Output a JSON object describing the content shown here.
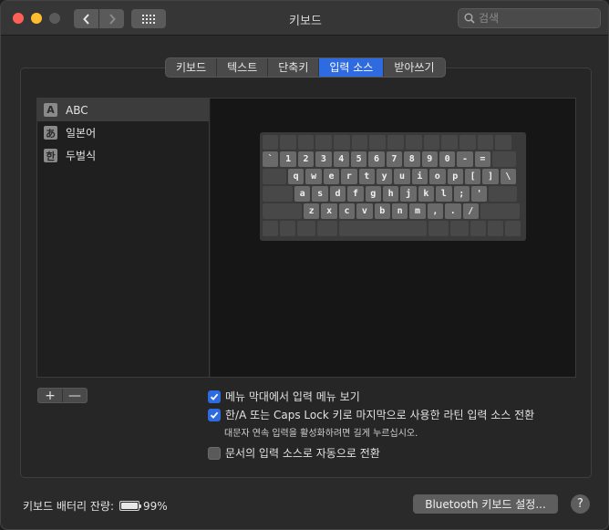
{
  "window": {
    "title": "키보드",
    "search_placeholder": "검색"
  },
  "tabs": [
    {
      "label": "키보드",
      "active": false
    },
    {
      "label": "텍스트",
      "active": false
    },
    {
      "label": "단축키",
      "active": false
    },
    {
      "label": "입력 소스",
      "active": true
    },
    {
      "label": "받아쓰기",
      "active": false
    }
  ],
  "input_sources": [
    {
      "icon_char": "A",
      "icon": "abc-icon",
      "label": "ABC",
      "selected": true
    },
    {
      "icon_char": "あ",
      "icon": "japanese-icon",
      "label": "일본어",
      "selected": false
    },
    {
      "icon_char": "한",
      "icon": "korean-icon",
      "label": "두벌식",
      "selected": false
    }
  ],
  "keyboard_rows": [
    [
      "`",
      "1",
      "2",
      "3",
      "4",
      "5",
      "6",
      "7",
      "8",
      "9",
      "0",
      "-",
      "="
    ],
    [
      "q",
      "w",
      "e",
      "r",
      "t",
      "y",
      "u",
      "i",
      "o",
      "p",
      "[",
      "]",
      "\\"
    ],
    [
      "a",
      "s",
      "d",
      "f",
      "g",
      "h",
      "j",
      "k",
      "l",
      ";",
      "'"
    ],
    [
      "z",
      "x",
      "c",
      "v",
      "b",
      "n",
      "m",
      ",",
      ".",
      "/"
    ]
  ],
  "list_buttons": {
    "add": "+",
    "remove": "—"
  },
  "options": {
    "show_menu": {
      "label": "메뉴 막대에서 입력 메뉴 보기",
      "checked": true
    },
    "caps_switch": {
      "label": "한/A 또는 Caps Lock 키로 마지막으로 사용한 라틴 입력 소스 전환",
      "checked": true
    },
    "caps_note": "대문자 연속 입력을 활성화하려면 길게 누르십시오.",
    "auto_switch": {
      "label": "문서의 입력 소스로 자동으로 전환",
      "checked": false
    }
  },
  "footer": {
    "battery_label": "키보드 배터리 잔량:",
    "battery_percent": "99%",
    "battery_level": 0.99,
    "bluetooth_button": "Bluetooth 키보드 설정...",
    "help": "?"
  },
  "colors": {
    "accent": "#2e6be0",
    "close": "#fe5f57",
    "minimize": "#febc2e"
  }
}
